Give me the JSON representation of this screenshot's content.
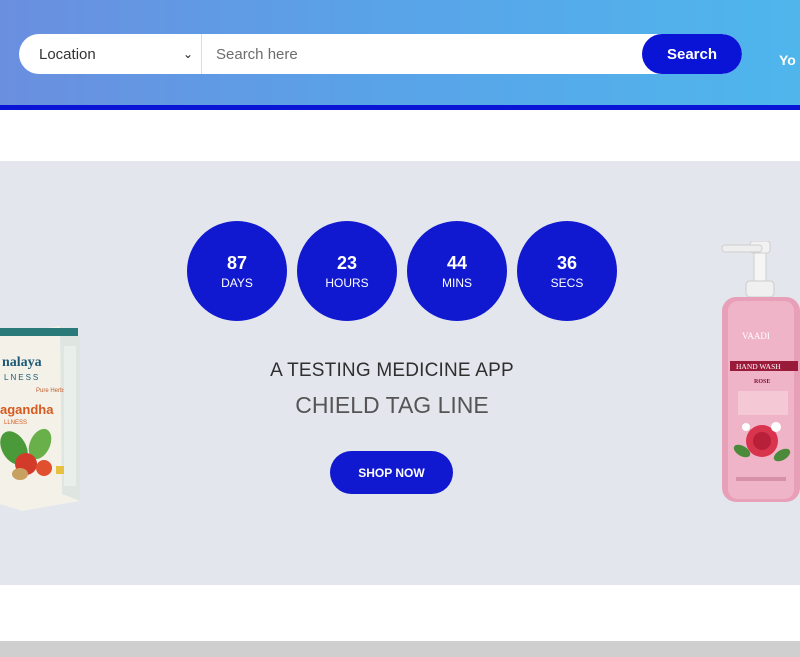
{
  "search": {
    "location_label": "Location",
    "placeholder": "Search here",
    "button_label": "Search"
  },
  "header": {
    "extra_text": "Yo"
  },
  "countdown": [
    {
      "value": "87",
      "unit": "DAYS"
    },
    {
      "value": "23",
      "unit": "HOURS"
    },
    {
      "value": "44",
      "unit": "MINS"
    },
    {
      "value": "36",
      "unit": "SECS"
    }
  ],
  "banner": {
    "title": "A TESTING MEDICINE APP",
    "tagline": "CHIELD TAG LINE",
    "button_label": "SHOP NOW"
  },
  "products": {
    "left_brand": "nalaya",
    "left_line": "LNESS",
    "left_sub": "Pure Herbs",
    "left_name": "agandha",
    "left_name2": "LLNESS",
    "right_brand": "VAADI",
    "right_name": "HAND WASH",
    "right_variant": "ROSE"
  },
  "colors": {
    "accent": "#0a14d6",
    "banner_bg": "#e4e6ee"
  }
}
